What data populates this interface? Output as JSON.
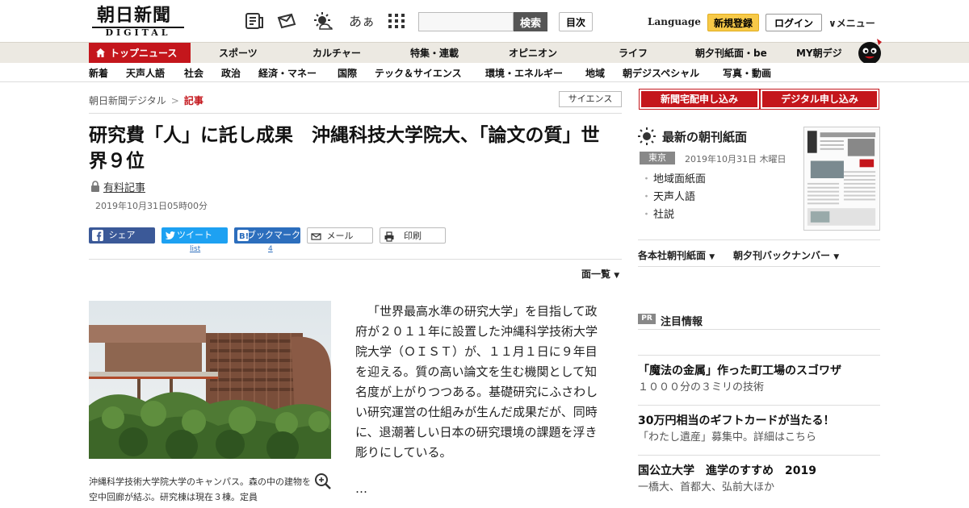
{
  "header": {
    "logo_main": "朝日新聞",
    "logo_sub": "DIGITAL",
    "aa_label": "あぁ",
    "search_placeholder": "",
    "search_button": "検索",
    "toc_button": "目次",
    "language": "Language",
    "signup": "新規登録",
    "login": "ログイン",
    "menu": "∨メニュー"
  },
  "nav_primary": [
    "トップニュース",
    "スポーツ",
    "カルチャー",
    "特集・連載",
    "オピニオン",
    "ライフ",
    "朝夕刊紙面・be",
    "MY朝デジ"
  ],
  "nav_secondary": [
    "新着",
    "天声人語",
    "社会",
    "政治",
    "経済・マネー",
    "国際",
    "テック＆サイエンス",
    "環境・エネルギー",
    "地域",
    "朝デジスペシャル",
    "写真・動画"
  ],
  "breadcrumb": {
    "home": "朝日新聞デジタル",
    "separator": ">",
    "current": "記事"
  },
  "genre": "サイエンス",
  "article": {
    "title": "研究費「人」に託し成果　沖縄科技大学院大、「論文の質」世界９位",
    "paid_label": "有料記事",
    "date": "2019年10月31日05時00分",
    "body": "「世界最高水準の研究大学」を目指して政府が２０１１年に設置した沖縄科学技術大学院大学（ＯＩＳＴ）が、１１月１日に９年目を迎える。質の高い論文を生む機関として知名度が上がりつつある。基礎研究にふさわしい研究運営の仕組みが生んだ成果だが、同時に、退潮著しい日本の研究環境の課題を浮き彫りにしている。",
    "ellipsis": "…",
    "caption": "沖縄科学技術大学院大学のキャンパス。森の中の建物を空中回廊が結ぶ。研究棟は現在３棟。定員",
    "menu_list": "面一覧"
  },
  "share": {
    "facebook": "シェア",
    "twitter": "ツイート",
    "hatena": "ブックマーク",
    "mail": "メール",
    "print": "印刷",
    "twitter_count": "list",
    "hatena_count": "4"
  },
  "sidebar": {
    "btn_paper": "新聞宅配申し込み",
    "btn_digital": "デジタル申し込み",
    "latest_title": "最新の朝刊紙面",
    "location": "東京",
    "date": "2019年10月31日 木曜日",
    "links": [
      "地域面紙面",
      "天声人語",
      "社説"
    ],
    "backnumber_1": "各本社朝刊紙面",
    "backnumber_2": "朝夕刊バックナンバー",
    "pr_badge": "PR",
    "attention": "注目情報",
    "pr_items": [
      {
        "headline": "「魔法の金属」作った町工場のスゴワザ",
        "sub": "１０００分の３ミリの技術"
      },
      {
        "headline": "30万円相当のギフトカードが当たる！",
        "sub": "「わたし遺産」募集中。詳細はこちら"
      },
      {
        "headline": "国公立大学　進学のすすめ　2019",
        "sub": "一橋大、首都大、弘前大ほか"
      }
    ]
  },
  "colors": {
    "brand_red": "#c4161c",
    "nav_bg": "#ece9e2",
    "signup_yellow": "#f7c948"
  }
}
